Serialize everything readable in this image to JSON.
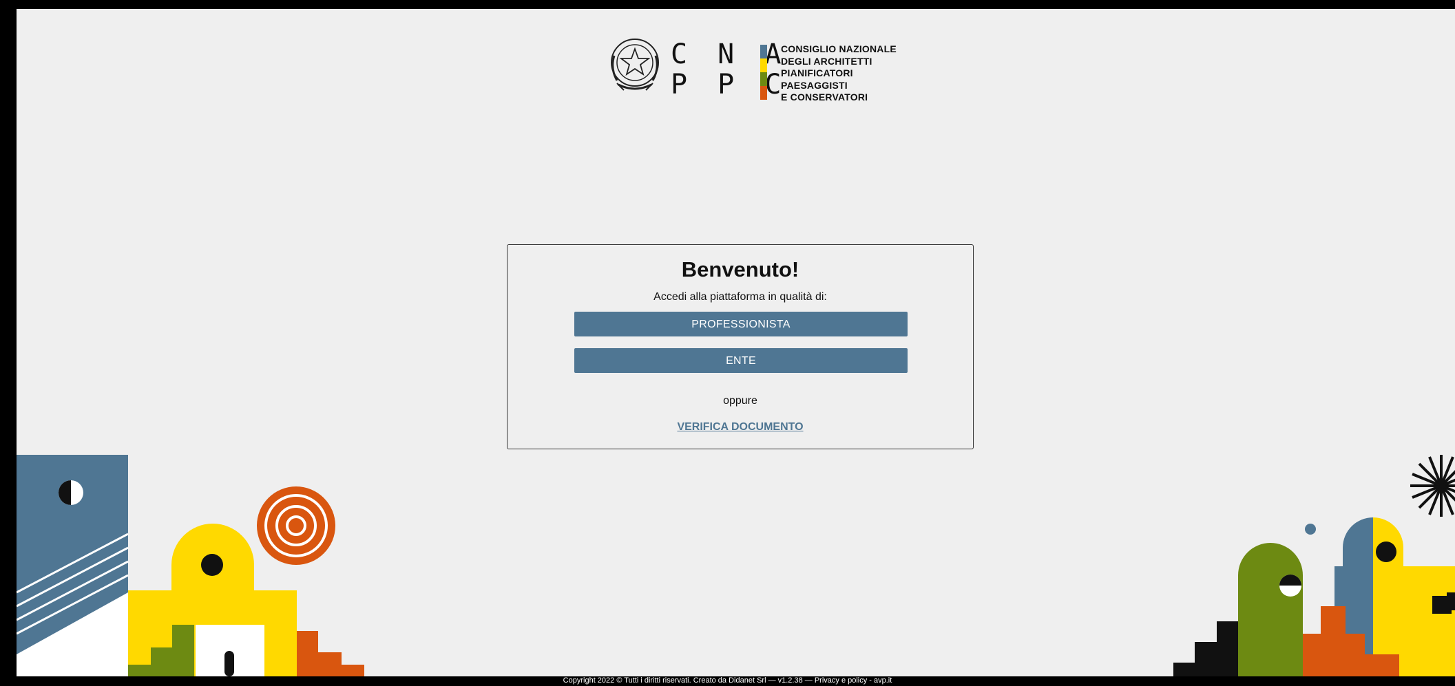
{
  "logo": {
    "letters_row1": "C N A",
    "letters_row2": "P P C",
    "org_lines": [
      "CONSIGLIO NAZIONALE",
      "DEGLI ARCHITETTI",
      "PIANIFICATORI",
      "PAESAGGISTI",
      "E CONSERVATORI"
    ],
    "bar_colors": [
      "#4f7693",
      "#ffd900",
      "#6d8a12",
      "#d9560f"
    ]
  },
  "card": {
    "title": "Benvenuto!",
    "subtitle": "Accedi alla piattaforma in qualità di:",
    "buttons": {
      "professionista": "PROFESSIONISTA",
      "ente": "ENTE"
    },
    "separator": "oppure",
    "verify_link": "VERIFICA DOCUMENTO"
  },
  "footer": {
    "text": "Copyright 2022 © Tutti i diritti riservati. Creato da Didanet Srl — v1.2.38 — Privacy e policy - avp.it"
  },
  "colors": {
    "accent": "#4f7693",
    "yellow": "#ffd900",
    "green": "#6d8a12",
    "orange": "#d9560f",
    "background": "#efefef"
  }
}
